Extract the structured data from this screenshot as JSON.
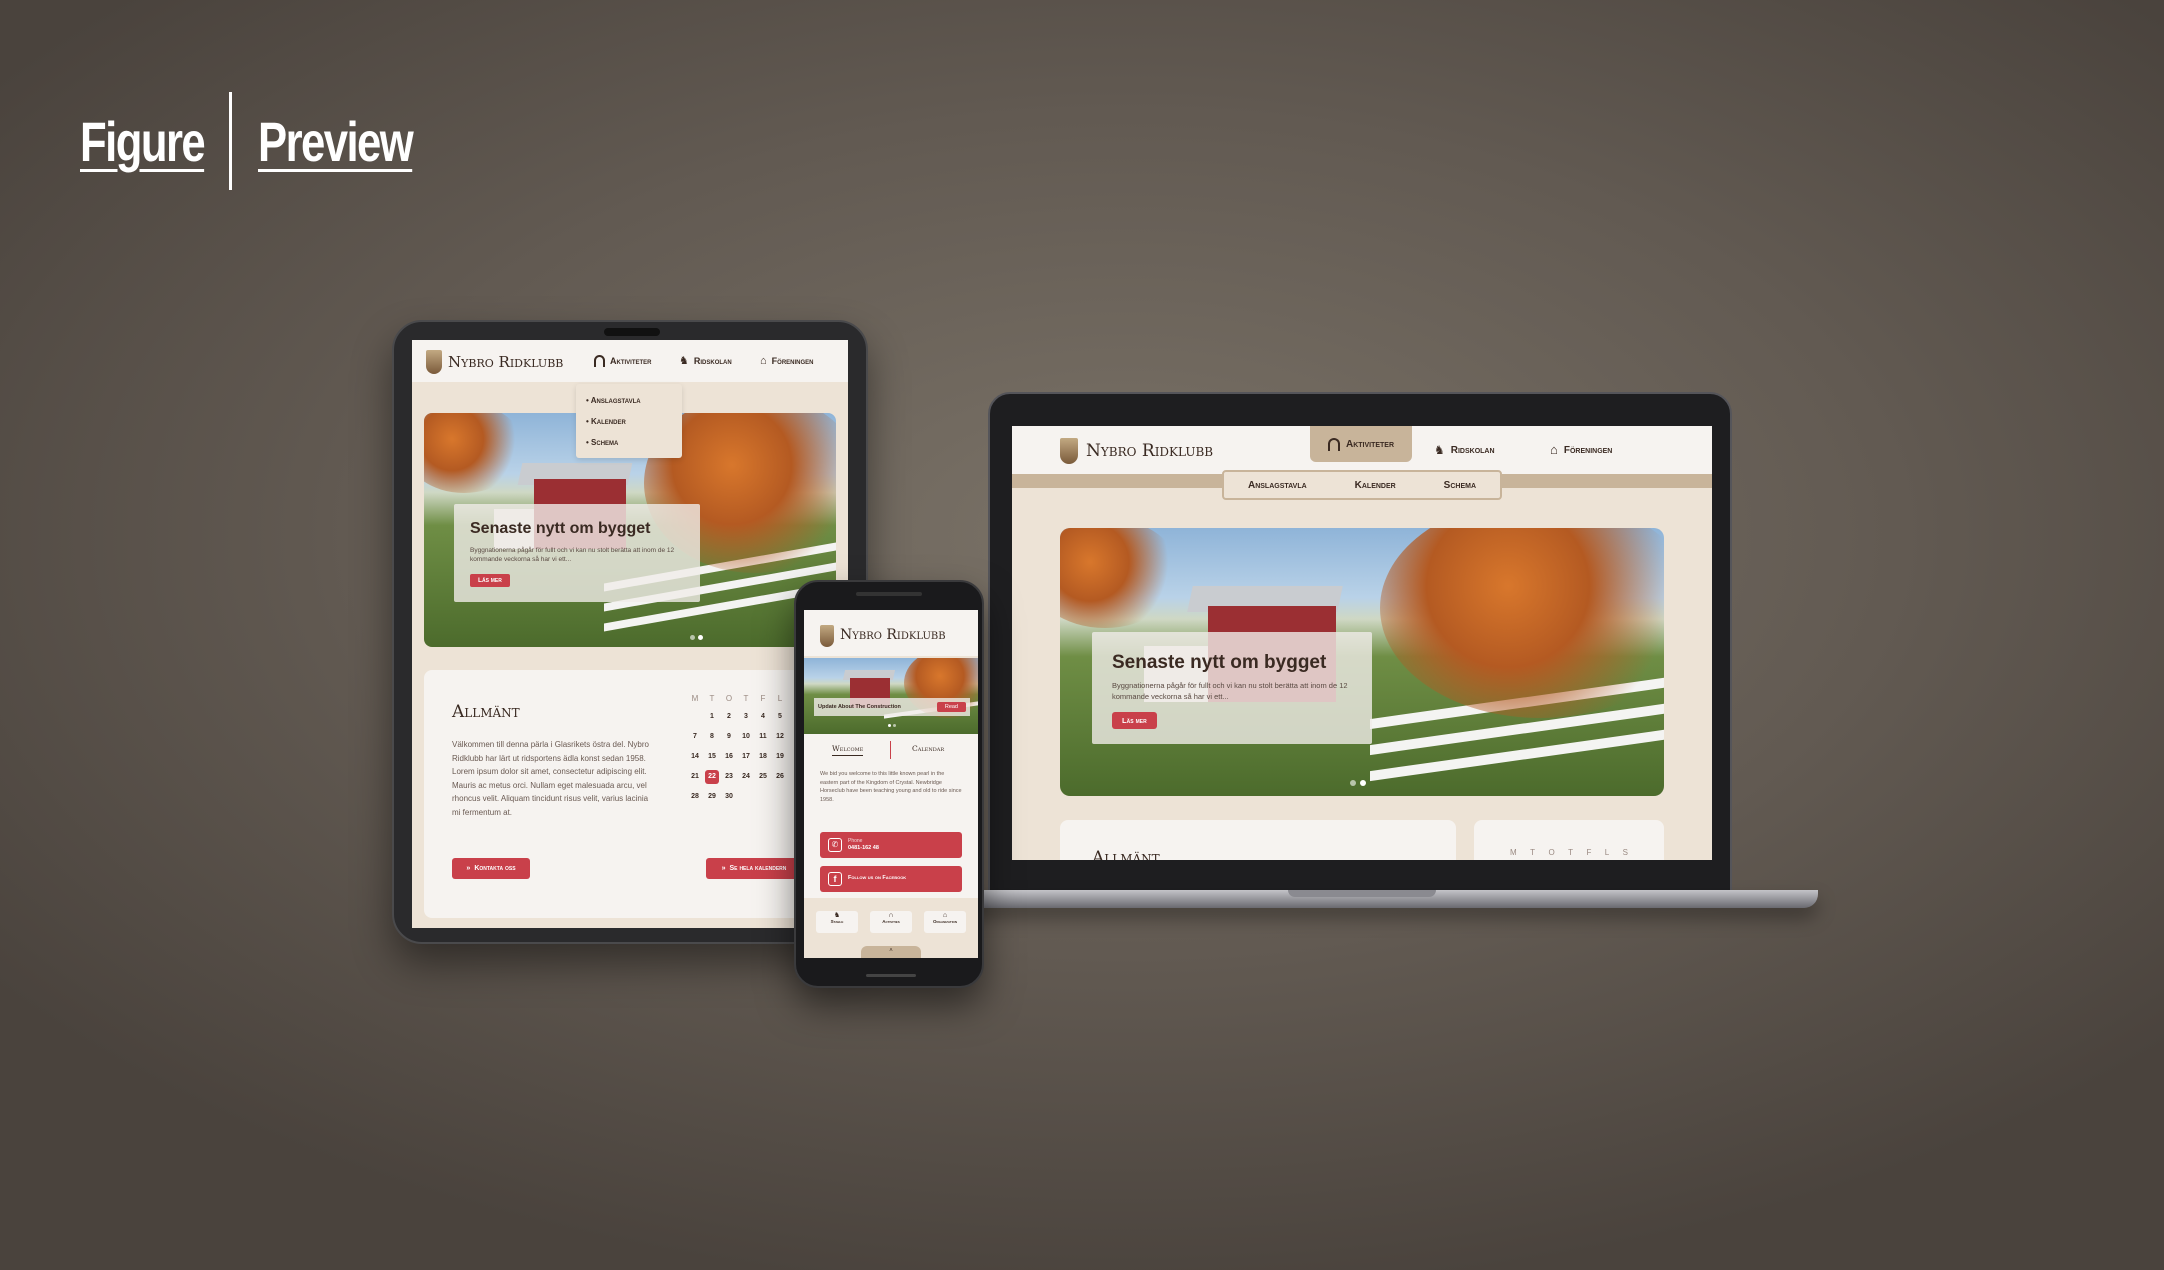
{
  "header": {
    "left": "Figure",
    "right": "Preview"
  },
  "brand": {
    "name": "Nybro Ridklubb"
  },
  "nav": {
    "activities": "Aktiviteter",
    "ridingschool": "Ridskolan",
    "association": "Föreningen"
  },
  "subnav": {
    "board": "Anslagstavla",
    "calendar": "Kalender",
    "schedule": "Schema"
  },
  "hero": {
    "title": "Senaste nytt om bygget",
    "text": "Byggnationerna pågår för fullt och vi kan nu stolt berätta att inom de 12 kommande veckorna så har vi ett...",
    "button": "Läs mer"
  },
  "general": {
    "title": "Allmänt",
    "text": "Välkommen till denna pärla i Glasrikets östra del. Nybro Ridklubb har lärt ut ridsportens ädla konst sedan 1958. Lorem ipsum dolor sit amet, consectetur adipiscing elit. Mauris ac metus orci. Nullam eget malesuada arcu, vel rhoncus velit. Aliquam tincidunt risus velit, varius lacinia mi fermentum at.",
    "contact_button": "Kontakta oss",
    "calendar_button": "Se hela kalendern"
  },
  "calendar": {
    "days": [
      "M",
      "T",
      "O",
      "T",
      "F",
      "L"
    ],
    "laptop_days": [
      "M",
      "T",
      "O",
      "T",
      "F",
      "L",
      "S"
    ],
    "rows": [
      [
        "",
        "1",
        "2",
        "3",
        "4",
        "5"
      ],
      [
        "7",
        "8",
        "9",
        "10",
        "11",
        "12"
      ],
      [
        "14",
        "15",
        "16",
        "17",
        "18",
        "19"
      ],
      [
        "21",
        "22",
        "23",
        "24",
        "25",
        "26"
      ],
      [
        "28",
        "29",
        "30",
        "",
        "",
        ""
      ]
    ],
    "today": "22"
  },
  "mobile": {
    "hero_caption": "Update About The Construction",
    "hero_button": "Read",
    "tab_welcome": "Welcome",
    "tab_calendar": "Calendar",
    "text": "We bid you welcome to this little known pearl in the eastern part of the Kingdom of Crystal. Newbridge Horseclub have been teaching young and old to ride since 1958.",
    "phone_label": "Phone",
    "phone_number": "0481-162 48",
    "facebook": "Follow us on Facebook",
    "bottom_nav": [
      "Stable",
      "Activities",
      "Organization"
    ]
  },
  "colors": {
    "accent": "#c9404a",
    "cream": "#ede3d6",
    "tan": "#c8b49a",
    "dark": "#3a2a22"
  }
}
